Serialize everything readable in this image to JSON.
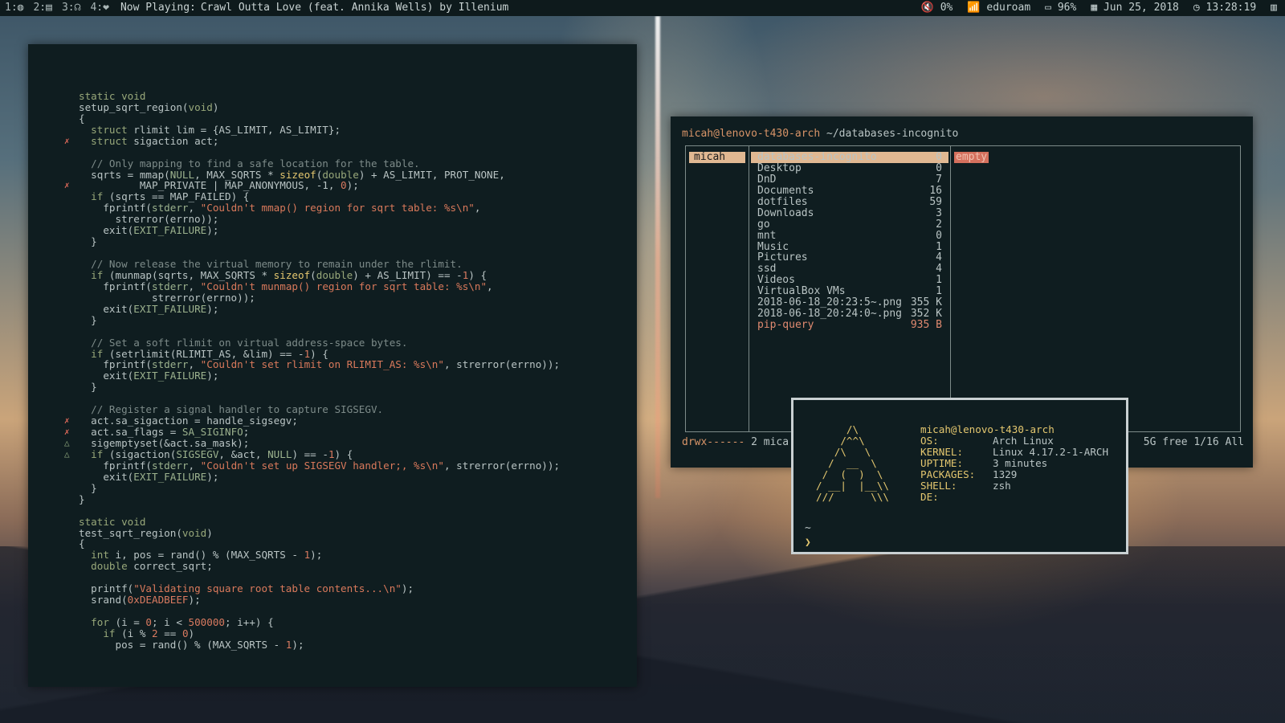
{
  "topbar": {
    "workspaces": [
      "1:◍",
      "2:▤",
      "3:☊",
      "4:❤"
    ],
    "now_playing_label": "Now Playing:",
    "now_playing_track": "Crawl Outta Love (feat. Annika Wells) by Illenium",
    "volume": "🔇 0%",
    "wifi": "📶 eduroam",
    "battery": "▭ 96%",
    "date": "▦ Jun 25, 2018",
    "time": "◷ 13:28:19",
    "menu_icon": "▥"
  },
  "editor": {
    "lines": [
      {
        "g": "",
        "h": ""
      },
      {
        "g": "",
        "h": "<span class=\"kw\">static</span> <span class=\"ty\">void</span>"
      },
      {
        "g": "",
        "h": "setup_sqrt_region(<span class=\"ty\">void</span>)"
      },
      {
        "g": "",
        "h": "{"
      },
      {
        "g": "",
        "h": "  <span class=\"kw\">struct</span> rlimit lim = {AS_LIMIT, AS_LIMIT};"
      },
      {
        "g": "x",
        "h": "  <span class=\"kw\">struct</span> sigaction act;"
      },
      {
        "g": "",
        "h": ""
      },
      {
        "g": "",
        "h": "  <span class=\"cm\">// Only mapping to find a safe location for the table.</span>"
      },
      {
        "g": "",
        "h": "  sqrts = mmap(<span class=\"cs\">NULL</span>, MAX_SQRTS * <span class=\"fn\">sizeof</span>(<span class=\"ty\">double</span>) + AS_LIMIT, PROT_NONE,"
      },
      {
        "g": "x",
        "h": "          MAP_PRIVATE | MAP_ANONYMOUS, -1, <span class=\"nm\">0</span>);"
      },
      {
        "g": "",
        "h": "  <span class=\"kw\">if</span> (sqrts == MAP_FAILED) {"
      },
      {
        "g": "",
        "h": "    fprintf(<span class=\"cs\">stderr</span>, <span class=\"st\">\"Couldn't mmap() region for sqrt table: %s\\n\"</span>,"
      },
      {
        "g": "",
        "h": "      strerror(errno));"
      },
      {
        "g": "",
        "h": "    exit(<span class=\"cs\">EXIT_FAILURE</span>);"
      },
      {
        "g": "",
        "h": "  }"
      },
      {
        "g": "",
        "h": ""
      },
      {
        "g": "",
        "h": "  <span class=\"cm\">// Now release the virtual memory to remain under the rlimit.</span>"
      },
      {
        "g": "",
        "h": "  <span class=\"kw\">if</span> (munmap(sqrts, MAX_SQRTS * <span class=\"fn\">sizeof</span>(<span class=\"ty\">double</span>) + AS_LIMIT) == -<span class=\"nm\">1</span>) {"
      },
      {
        "g": "",
        "h": "    fprintf(<span class=\"cs\">stderr</span>, <span class=\"st\">\"Couldn't munmap() region for sqrt table: %s\\n\"</span>,"
      },
      {
        "g": "",
        "h": "            strerror(errno));"
      },
      {
        "g": "",
        "h": "    exit(<span class=\"cs\">EXIT_FAILURE</span>);"
      },
      {
        "g": "",
        "h": "  }"
      },
      {
        "g": "",
        "h": ""
      },
      {
        "g": "",
        "h": "  <span class=\"cm\">// Set a soft rlimit on virtual address-space bytes.</span>"
      },
      {
        "g": "",
        "h": "  <span class=\"kw\">if</span> (setrlimit(RLIMIT_AS, &amp;lim) == -<span class=\"nm\">1</span>) {"
      },
      {
        "g": "",
        "h": "    fprintf(<span class=\"cs\">stderr</span>, <span class=\"st\">\"Couldn't set rlimit on RLIMIT_AS: %s\\n\"</span>, strerror(errno));"
      },
      {
        "g": "",
        "h": "    exit(<span class=\"cs\">EXIT_FAILURE</span>);"
      },
      {
        "g": "",
        "h": "  }"
      },
      {
        "g": "",
        "h": ""
      },
      {
        "g": "",
        "h": "  <span class=\"cm\">// Register a signal handler to capture SIGSEGV.</span>"
      },
      {
        "g": "x",
        "h": "  act.sa_sigaction = handle_sigsegv;"
      },
      {
        "g": "x",
        "h": "  act.sa_flags = <span class=\"cs\">SA_SIGINFO</span>;"
      },
      {
        "g": "w",
        "h": "  sigemptyset(&amp;act.sa_mask);"
      },
      {
        "g": "w",
        "h": "  <span class=\"kw\">if</span> (sigaction(<span class=\"cs\">SIGSEGV</span>, &amp;act, <span class=\"cs\">NULL</span>) == -<span class=\"nm\">1</span>) {"
      },
      {
        "g": "",
        "h": "    fprintf(<span class=\"cs\">stderr</span>, <span class=\"st\">\"Couldn't set up SIGSEGV handler;, %s\\n\"</span>, strerror(errno));"
      },
      {
        "g": "",
        "h": "    exit(<span class=\"cs\">EXIT_FAILURE</span>);"
      },
      {
        "g": "",
        "h": "  }"
      },
      {
        "g": "",
        "h": "}"
      },
      {
        "g": "",
        "h": ""
      },
      {
        "g": "",
        "h": "<span class=\"kw\">static</span> <span class=\"ty\">void</span>"
      },
      {
        "g": "",
        "h": "test_sqrt_region(<span class=\"ty\">void</span>)"
      },
      {
        "g": "",
        "h": "{"
      },
      {
        "g": "",
        "h": "  <span class=\"ty\">int</span> i, pos = rand() % (MAX_SQRTS - <span class=\"nm\">1</span>);"
      },
      {
        "g": "",
        "h": "  <span class=\"ty\">double</span> correct_sqrt;"
      },
      {
        "g": "",
        "h": ""
      },
      {
        "g": "",
        "h": "  printf(<span class=\"st\">\"Validating square root table contents...\\n\"</span>);"
      },
      {
        "g": "",
        "h": "  srand(<span class=\"nm\">0xDEADBEEF</span>);"
      },
      {
        "g": "",
        "h": ""
      },
      {
        "g": "",
        "h": "  <span class=\"kw\">for</span> (i = <span class=\"nm\">0</span>; i &lt; <span class=\"nm\">500000</span>; i++) {"
      },
      {
        "g": "",
        "h": "    <span class=\"kw\">if</span> (i % <span class=\"nm\">2</span> == <span class=\"nm\">0</span>)"
      },
      {
        "g": "",
        "h": "      pos = rand() % (MAX_SQRTS - <span class=\"nm\">1</span>);"
      }
    ],
    "gutter_x": "✗",
    "gutter_w": "△"
  },
  "filemanager": {
    "user_host": "micah@lenovo-t430-arch",
    "path": " ~/databases-incognito",
    "parent_item": "micah",
    "entries": [
      {
        "name": "databases-incognito",
        "size": "0",
        "selected": true,
        "kind": "dir"
      },
      {
        "name": "Desktop",
        "size": "0",
        "kind": "dir"
      },
      {
        "name": "DnD",
        "size": "7",
        "kind": "dir"
      },
      {
        "name": "Documents",
        "size": "16",
        "kind": "dir"
      },
      {
        "name": "dotfiles",
        "size": "59",
        "kind": "dir"
      },
      {
        "name": "Downloads",
        "size": "3",
        "kind": "dir"
      },
      {
        "name": "go",
        "size": "2",
        "kind": "dir"
      },
      {
        "name": "mnt",
        "size": "0",
        "kind": "dir"
      },
      {
        "name": "Music",
        "size": "1",
        "kind": "dir"
      },
      {
        "name": "Pictures",
        "size": "4",
        "kind": "dir"
      },
      {
        "name": "ssd",
        "size": "4",
        "kind": "dir"
      },
      {
        "name": "Videos",
        "size": "1",
        "kind": "dir"
      },
      {
        "name": "VirtualBox VMs",
        "size": "1",
        "kind": "dir"
      },
      {
        "name": "2018-06-18_20:23:5~.png",
        "size": "355 K",
        "kind": "file"
      },
      {
        "name": "2018-06-18_20:24:0~.png",
        "size": "352 K",
        "kind": "file"
      },
      {
        "name": "pip-query",
        "size": "935 B",
        "kind": "hot"
      }
    ],
    "preview": "empty",
    "status_perm": "drwx------",
    "status_owner": " 2 mica",
    "status_right": "5G free   1/16   All"
  },
  "neofetch": {
    "ascii": "     /\\\n    /^^\\\n   /\\   \\\n  /  __  \\\n /  (  )  \\\n/ __|  |__\\\\\n///      \\\\\\",
    "user_host": "micah@lenovo-t430-arch",
    "fields": [
      {
        "k": "OS:",
        "v": "Arch Linux"
      },
      {
        "k": "KERNEL:",
        "v": "Linux 4.17.2-1-ARCH"
      },
      {
        "k": "UPTIME:",
        "v": "3 minutes"
      },
      {
        "k": "PACKAGES:",
        "v": "1329"
      },
      {
        "k": "SHELL:",
        "v": "zsh"
      },
      {
        "k": "DE:",
        "v": ""
      }
    ],
    "prompt_dir": "~",
    "prompt_symbol": "❯"
  }
}
